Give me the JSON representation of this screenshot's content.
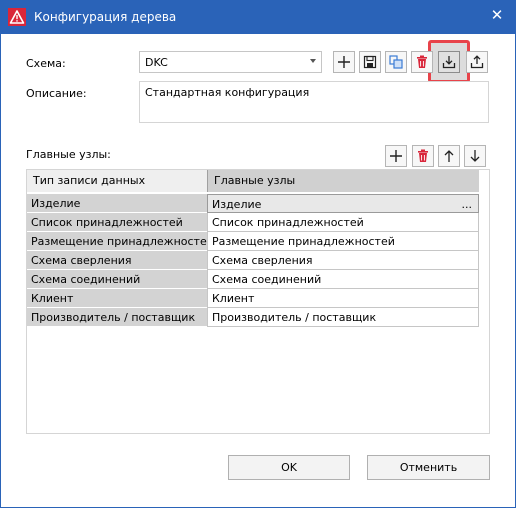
{
  "window": {
    "title": "Конфигурация дерева",
    "close_glyph": "✕"
  },
  "schema": {
    "label": "Схема:",
    "value": "DKC",
    "toolbar": [
      "plus-icon",
      "save-icon",
      "copy-icon",
      "delete-icon",
      "import-icon",
      "export-icon"
    ]
  },
  "description": {
    "label": "Описание:",
    "value": "Стандартная конфигурация"
  },
  "main_nodes": {
    "label": "Главные узлы:",
    "toolbar": [
      "plus-icon",
      "delete-icon",
      "arrow-up-icon",
      "arrow-down-icon"
    ],
    "columns": [
      "Тип записи данных",
      "Главные узлы"
    ],
    "rows": [
      {
        "type": "Изделие",
        "node": "Изделие",
        "selected": true,
        "ellipsis": "..."
      },
      {
        "type": "Список принадлежностей",
        "node": "Список принадлежностей"
      },
      {
        "type": "Размещение принадлежностей",
        "node": "Размещение принадлежностей"
      },
      {
        "type": "Схема сверления",
        "node": "Схема сверления"
      },
      {
        "type": "Схема соединений",
        "node": "Схема соединений"
      },
      {
        "type": "Клиент",
        "node": "Клиент"
      },
      {
        "type": "Производитель / поставщик",
        "node": "Производитель / поставщик"
      }
    ]
  },
  "buttons": {
    "ok": "OK",
    "cancel": "Отменить"
  },
  "colors": {
    "titlebar": "#2a63b8",
    "highlight": "#e8434a",
    "delete_red": "#d9263a",
    "copy_blue": "#3a7bd5"
  }
}
